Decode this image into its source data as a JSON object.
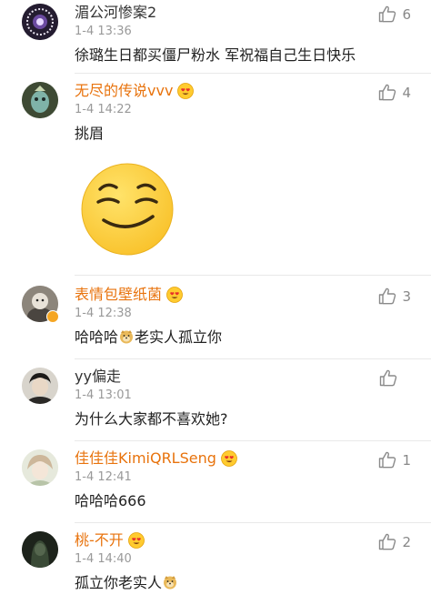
{
  "comments": [
    {
      "name": "湄公河惨案2",
      "time": "1-4 13:36",
      "text": "徐璐生日都买僵尸粉水 军祝福自己生日快乐",
      "likes": "6"
    },
    {
      "name": "无尽的传说vvv",
      "time": "1-4 14:22",
      "text": "挑眉",
      "likes": "4"
    },
    {
      "name": "表情包壁纸菌",
      "time": "1-4 12:38",
      "text_before": "哈哈哈",
      "text_after": "老实人孤立你",
      "likes": "3"
    },
    {
      "name": "yy偏走",
      "time": "1-4 13:01",
      "text": "为什么大家都不喜欢她?",
      "likes": ""
    },
    {
      "name": "佳佳佳KimiQRLSeng",
      "time": "1-4 12:41",
      "text": "哈哈哈666",
      "likes": "1"
    },
    {
      "name": "桃-不开",
      "time": "1-4 14:40",
      "text": "孤立你老实人",
      "likes": "2"
    }
  ],
  "colors": {
    "gold_name": "#e8730d",
    "plain_name": "#333333",
    "time": "#999999",
    "divider": "#e9e9e9"
  },
  "icons": {
    "like": "thumbs-up-icon",
    "vip": "heart-eyes-badge-icon",
    "smile": "smirk-emoji",
    "doge": "doge-emoji"
  }
}
